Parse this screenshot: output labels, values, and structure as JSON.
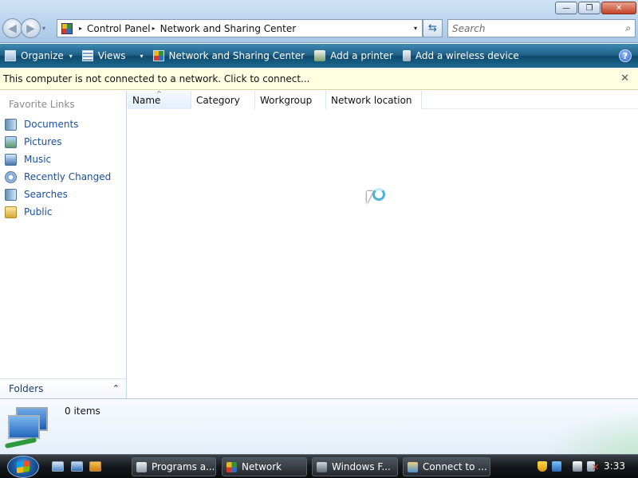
{
  "window": {
    "controls": {
      "minimize": "—",
      "maximize": "❐",
      "close": "✕"
    }
  },
  "navigation": {
    "back": "◀",
    "forward": "▶",
    "dropdown": "▾"
  },
  "address": {
    "breadcrumbs": [
      "Control Panel",
      "Network and Sharing Center"
    ],
    "separator": "▸",
    "dropdown": "▾",
    "refresh": "⇆"
  },
  "search": {
    "placeholder": "Search",
    "icon": "search-icon",
    "glyph": "⌕"
  },
  "toolbar": {
    "organize": "Organize",
    "views": "Views",
    "network_and_sharing_center": "Network and Sharing Center",
    "add_printer": "Add a printer",
    "add_wireless_device": "Add a wireless device",
    "dropdown": "▾",
    "help": "?"
  },
  "infobar": {
    "message": "This computer is not connected to a network. Click to connect...",
    "close": "✕"
  },
  "sidebar": {
    "favorites_title": "Favorite Links",
    "items": [
      {
        "label": "Documents",
        "icon": "documents-icon"
      },
      {
        "label": "Pictures",
        "icon": "pictures-icon"
      },
      {
        "label": "Music",
        "icon": "music-icon"
      },
      {
        "label": "Recently Changed",
        "icon": "recently-changed-icon"
      },
      {
        "label": "Searches",
        "icon": "searches-icon"
      },
      {
        "label": "Public",
        "icon": "public-folder-icon"
      }
    ],
    "folders_label": "Folders",
    "folders_chevron": "⌃"
  },
  "filelist": {
    "columns": [
      "Name",
      "Category",
      "Workgroup",
      "Network location"
    ],
    "sorted_column": "Name",
    "sort_indicator": "^",
    "rows": []
  },
  "details": {
    "items_count": "0 items"
  },
  "taskbar": {
    "buttons": [
      "Programs a...",
      "Network",
      "Windows F...",
      "Connect to ..."
    ],
    "clock": "3:33",
    "tray_error": "✕"
  },
  "colors": {
    "command_bar": "#1f5f87",
    "infobar_bg": "#ffffe1",
    "link": "#1a4fa0",
    "taskbar": "#15191d"
  }
}
